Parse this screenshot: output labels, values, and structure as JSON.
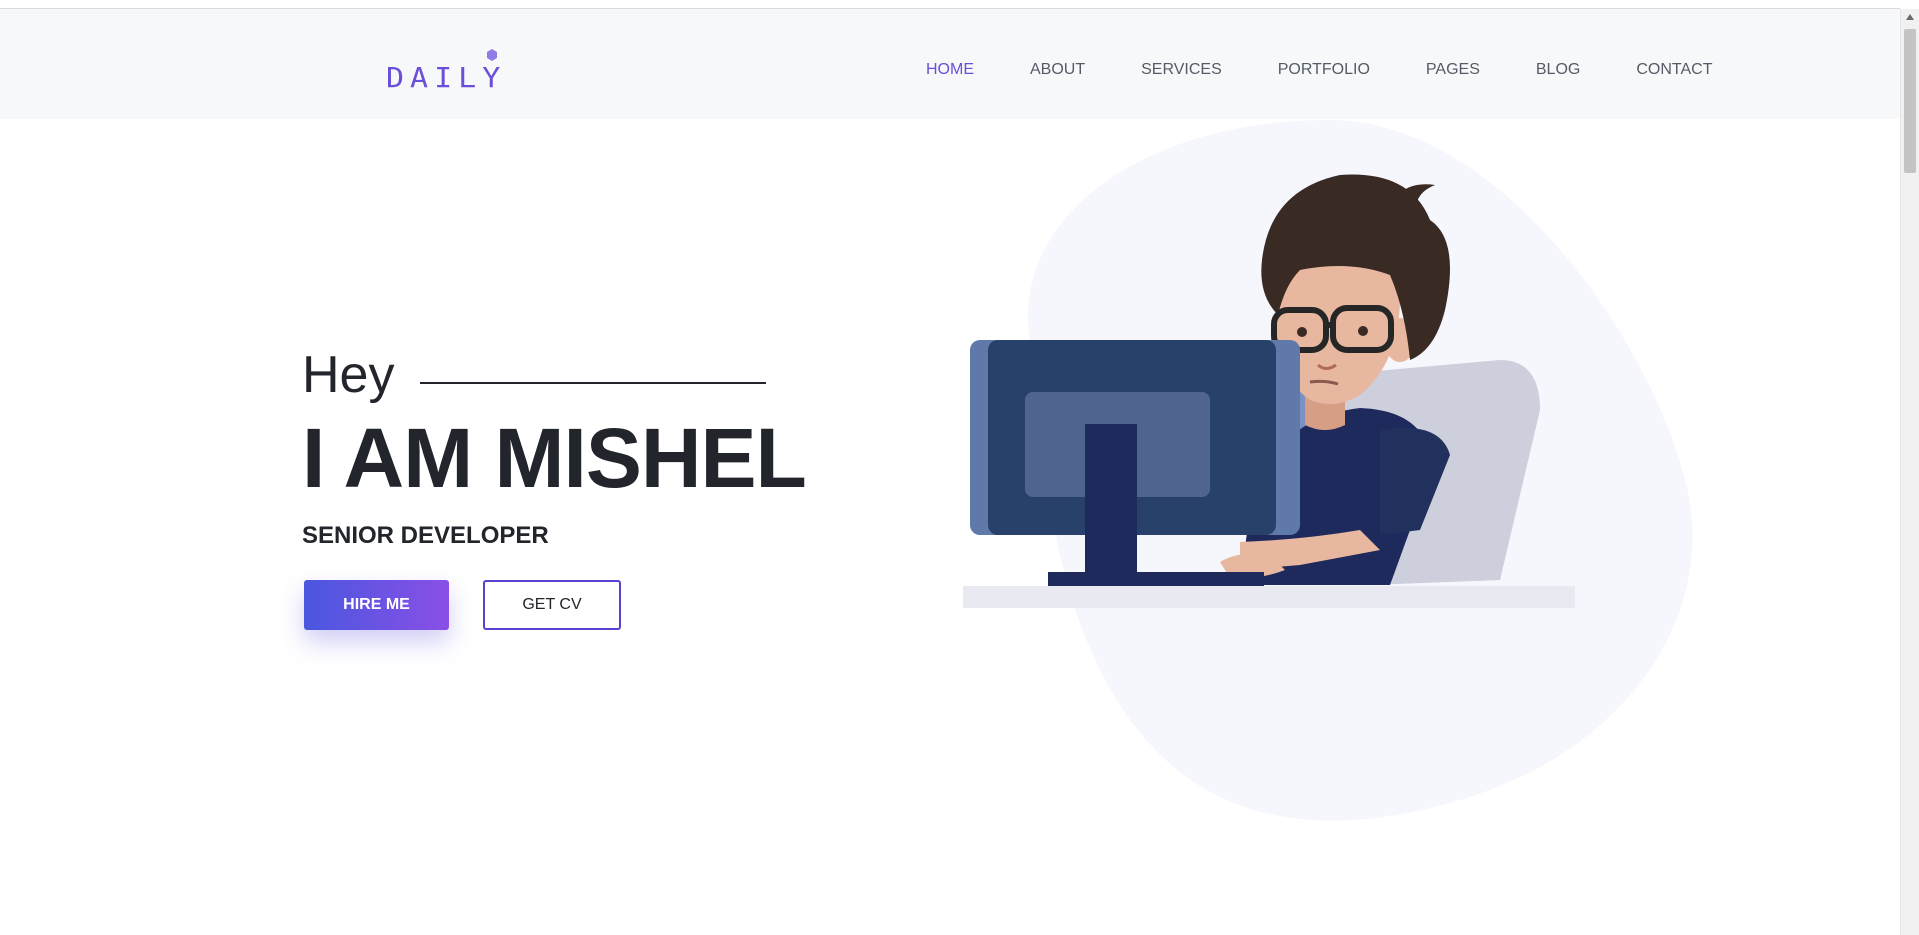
{
  "brand": {
    "logo_text": "DAILY",
    "accent": "#6a4fd8",
    "dot_color": "#8f7ae8"
  },
  "nav": {
    "items": [
      {
        "label": "HOME",
        "active": true
      },
      {
        "label": "ABOUT",
        "active": false
      },
      {
        "label": "SERVICES",
        "active": false
      },
      {
        "label": "PORTFOLIO",
        "active": false
      },
      {
        "label": "PAGES",
        "active": false
      },
      {
        "label": "BLOG",
        "active": false
      },
      {
        "label": "CONTACT",
        "active": false
      }
    ]
  },
  "hero": {
    "greeting": "Hey",
    "name": "I AM MISHEL",
    "role": "SENIOR DEVELOPER",
    "hire_label": "HIRE ME",
    "cv_label": "GET CV"
  },
  "illustration": {
    "icon": "developer-at-computer-illustration",
    "colors": {
      "blob": "#f6f6fd",
      "monitor": "#27416a",
      "shirt": "#1f2a5c",
      "hair": "#3a2a24",
      "skin": "#e8b7a0",
      "chair": "#cdcfdc",
      "desk": "#e8e9f1"
    }
  }
}
